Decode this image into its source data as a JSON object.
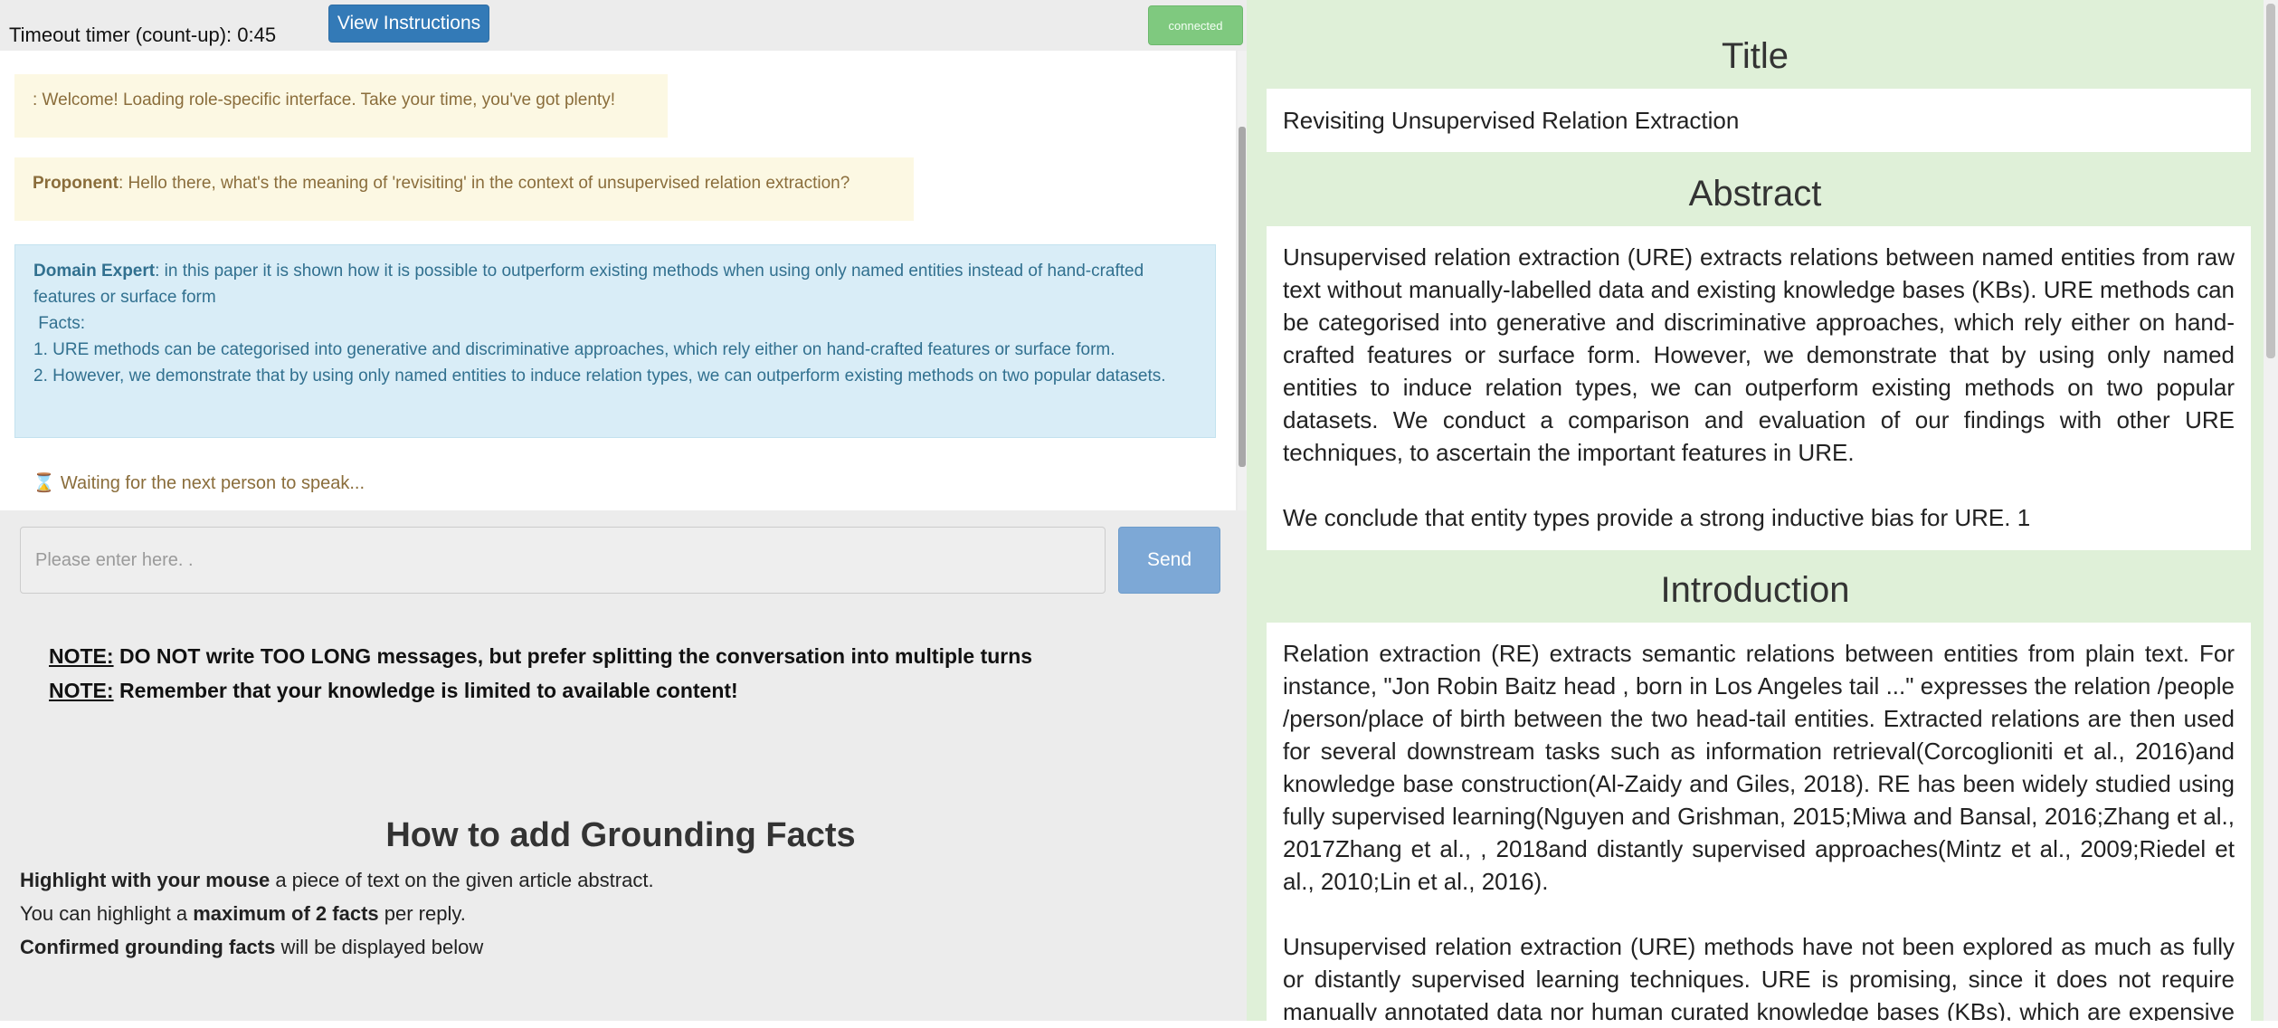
{
  "topbar": {
    "timer_label": "Timeout timer (count-up):",
    "timer_value": "0:45",
    "view_instructions_label": "View Instructions",
    "connected_label": "connected"
  },
  "chat": {
    "messages": [
      {
        "speaker": "",
        "text": ": Welcome! Loading role-specific interface. Take your time, you've got plenty!",
        "style": "warning"
      },
      {
        "speaker": "Proponent",
        "text": ": Hello there, what's the meaning of 'revisiting' in the context of unsupervised relation extraction?",
        "style": "warning"
      },
      {
        "speaker": "Domain Expert",
        "text": ": in this paper it is shown how it is possible to outperform existing methods when using only named entities instead of hand-crafted features or surface form",
        "facts_label": "Facts:",
        "facts": [
          "1. URE methods can be categorised into generative and discriminative approaches, which rely either on hand-crafted features or surface form.",
          "2. However, we demonstrate that by using only named entities to induce relation types, we can outperform existing methods on two popular datasets."
        ],
        "style": "info"
      }
    ],
    "waiting_icon": "hourglass-icon",
    "waiting_text": "Waiting for the next person to speak..."
  },
  "input": {
    "placeholder": "Please enter here. .",
    "value": "",
    "send_label": "Send"
  },
  "notes": [
    {
      "label": "NOTE:",
      "text": " DO NOT write TOO LONG messages, but prefer splitting the conversation into multiple turns"
    },
    {
      "label": "NOTE:",
      "text": " Remember that your knowledge is limited to available content!"
    }
  ],
  "howto": {
    "title": "How to add Grounding Facts",
    "line1_bold": "Highlight with your mouse",
    "line1_rest": " a piece of text on the given article abstract.",
    "line2_pre": "You can highlight a ",
    "line2_bold": "maximum of 2 facts",
    "line2_post": " per reply.",
    "line3_bold": "Confirmed grounding facts",
    "line3_rest": " will be displayed below"
  },
  "article": {
    "title_heading": "Title",
    "title": "Revisiting Unsupervised Relation Extraction",
    "abstract_heading": "Abstract",
    "abstract_p1": "Unsupervised relation extraction (URE) extracts relations between named entities from raw text without manually-labelled data and existing knowledge bases (KBs). URE methods can be categorised into generative and discriminative approaches, which rely either on hand-crafted features or surface form. However, we demonstrate that by using only named entities to induce relation types, we can outperform existing methods on two popular datasets. We conduct a comparison and evaluation of our findings with other URE techniques, to ascertain the important features in URE.",
    "abstract_p2": "We conclude that entity types provide a strong inductive bias for URE. 1",
    "intro_heading": "Introduction",
    "intro_p1": "Relation extraction (RE) extracts semantic relations between entities from plain text. For instance, \"Jon Robin Baitz head , born in Los Angeles tail ...\" expresses the relation /people /person/place of birth between the two head-tail entities. Extracted relations are then used for several downstream tasks such as information retrieval(Corcoglioniti et al., 2016)and knowledge base construction(Al-Zaidy and Giles, 2018). RE has been widely studied using fully supervised learning(Nguyen and Grishman, 2015;Miwa and Bansal, 2016;Zhang et al., 2017Zhang et al., , 2018and distantly supervised approaches(Mintz et al., 2009;Riedel et al., 2010;Lin et al., 2016).",
    "intro_p2": "Unsupervised relation extraction (URE) methods have not been explored as much as fully or distantly supervised learning techniques. URE is promising, since it does not require manually annotated data nor human curated knowledge bases (KBs), which are expensive to produce."
  },
  "colors": {
    "warning_bg": "#fcf8e3",
    "info_bg": "#d9edf7",
    "primary_button": "#337ab7",
    "connected_button": "#7fc97f",
    "article_bg": "#dff0d8"
  }
}
